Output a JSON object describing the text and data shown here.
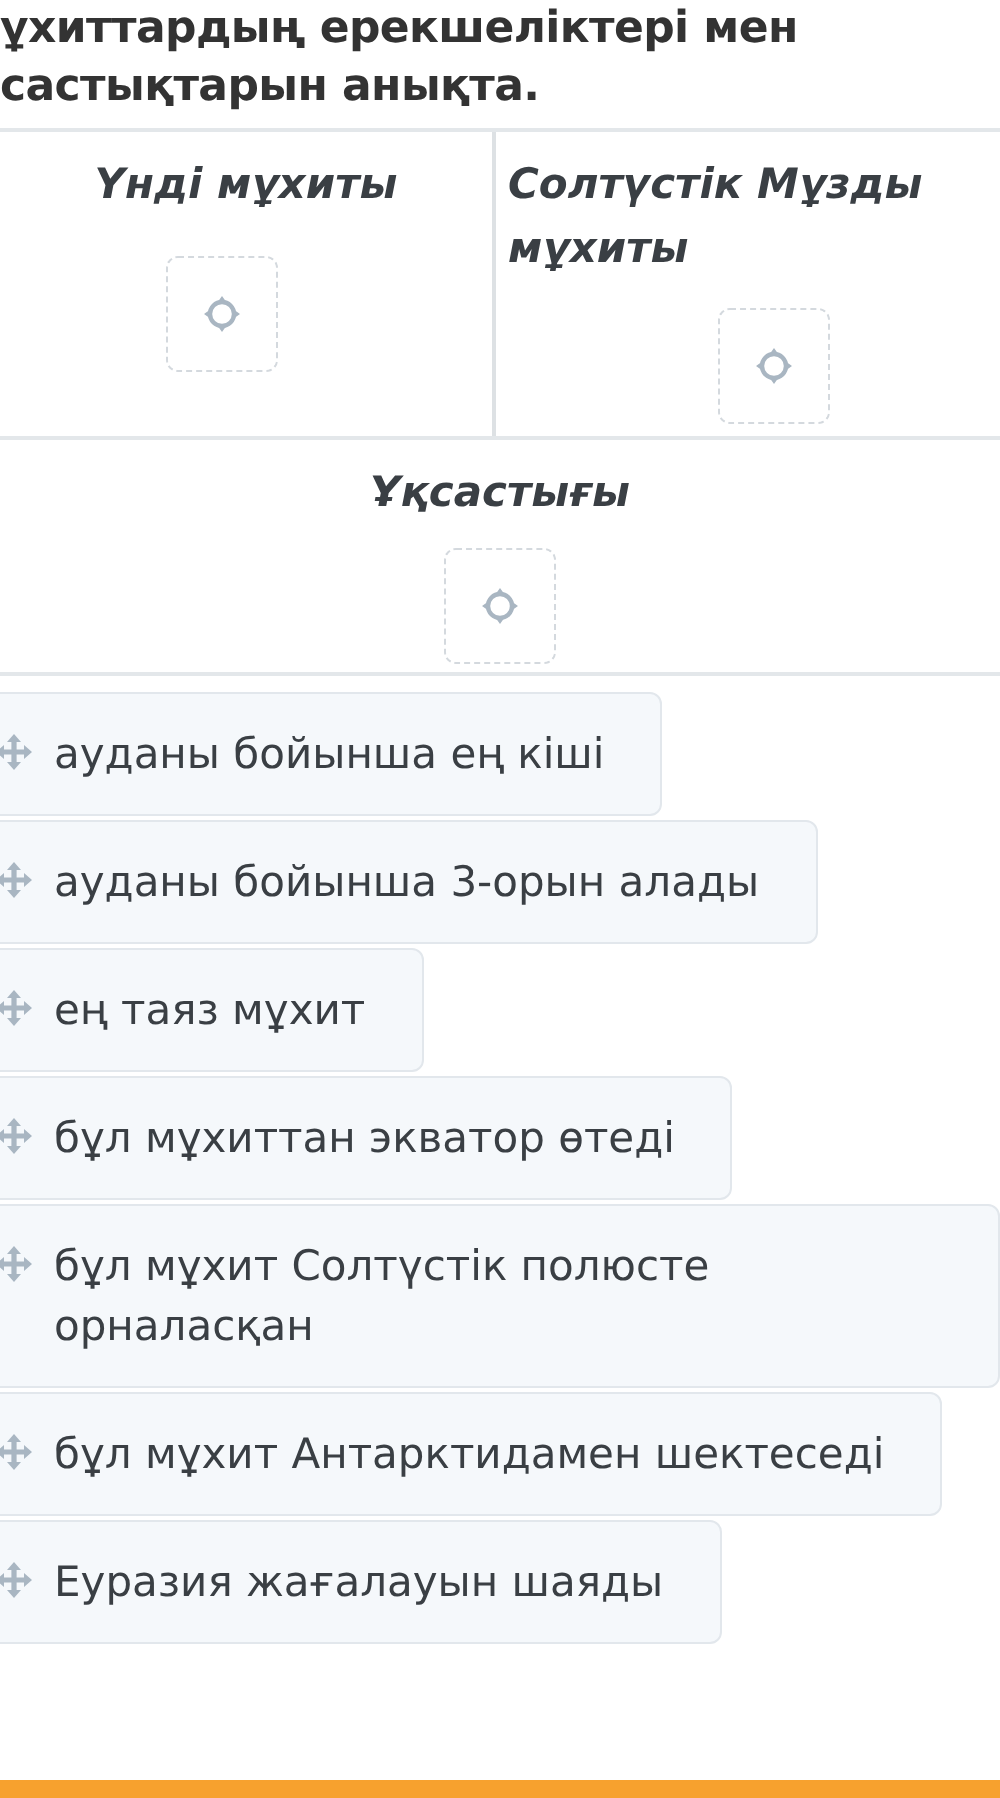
{
  "question": {
    "text": "ұхиттардың ерекшеліктері мен\nсастықтарын анықта."
  },
  "columns": [
    {
      "heading": "Үнді мұхиты"
    },
    {
      "heading": "Солтүстік Мұзды мұхиты"
    }
  ],
  "common_row": {
    "heading": "Ұқсастығы"
  },
  "options": [
    {
      "text": "ауданы бойынша ең кіші"
    },
    {
      "text": "ауданы бойынша 3-орын алады"
    },
    {
      "text": "ең таяз мұхит"
    },
    {
      "text": "бұл мұхиттан экватор өтеді"
    },
    {
      "text": "бұл мұхит Солтүстік полюсте орналасқан"
    },
    {
      "text": "бұл мұхит Антарктидамен шектеседі"
    },
    {
      "text": "Еуразия жағалауын шаяды"
    }
  ]
}
